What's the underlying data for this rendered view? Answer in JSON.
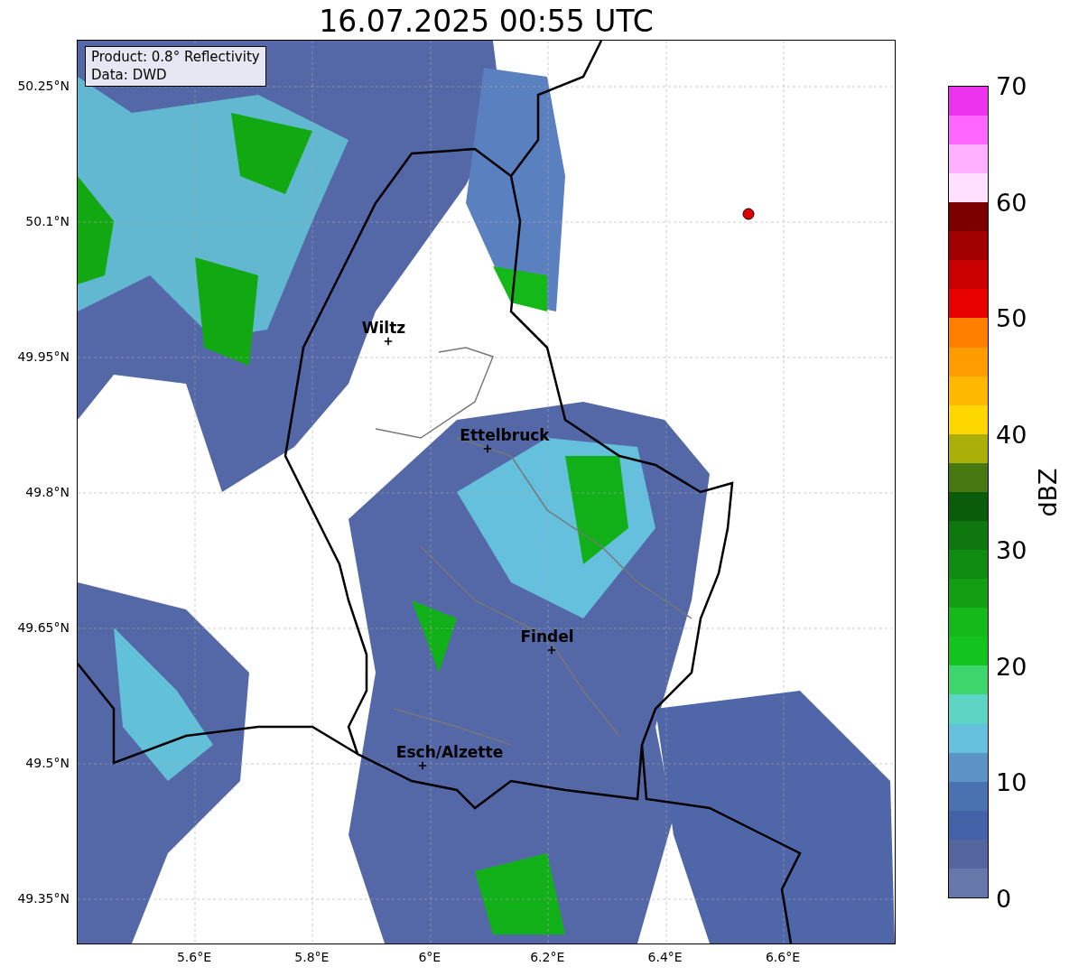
{
  "title": "16.07.2025 00:55 UTC",
  "info_box": [
    "Product: 0.8° Reflectivity",
    "Data: DWD"
  ],
  "lat_ticks": [
    "50.25°N",
    "50.1°N",
    "49.95°N",
    "49.8°N",
    "49.65°N",
    "49.5°N",
    "49.35°N"
  ],
  "lon_ticks": [
    "5.6°E",
    "5.8°E",
    "6°E",
    "6.2°E",
    "6.4°E",
    "6.6°E"
  ],
  "cities": [
    {
      "name": "Wiltz"
    },
    {
      "name": "Ettelbruck"
    },
    {
      "name": "Findel"
    },
    {
      "name": "Esch/Alzette"
    }
  ],
  "colorbar": {
    "label": "dBZ",
    "ticks": [
      "70",
      "60",
      "50",
      "40",
      "30",
      "20",
      "10",
      "0"
    ],
    "segments": [
      {
        "color": "#6677aa"
      },
      {
        "color": "#55669f"
      },
      {
        "color": "#4462a8"
      },
      {
        "color": "#4a72b0"
      },
      {
        "color": "#5a93c4"
      },
      {
        "color": "#64c0dc"
      },
      {
        "color": "#5ed4c4"
      },
      {
        "color": "#3cd66c"
      },
      {
        "color": "#14c41e"
      },
      {
        "color": "#14b818"
      },
      {
        "color": "#12a012"
      },
      {
        "color": "#108c10"
      },
      {
        "color": "#0e780e"
      },
      {
        "color": "#0a5c0a"
      },
      {
        "color": "#467a10"
      },
      {
        "color": "#aab008"
      },
      {
        "color": "#ffd700"
      },
      {
        "color": "#ffb800"
      },
      {
        "color": "#ff9c00"
      },
      {
        "color": "#ff7f00"
      },
      {
        "color": "#e60000"
      },
      {
        "color": "#c80000"
      },
      {
        "color": "#a00000"
      },
      {
        "color": "#7a0000"
      },
      {
        "color": "#ffe0ff"
      },
      {
        "color": "#ffb0ff"
      },
      {
        "color": "#ff66ff"
      },
      {
        "color": "#ee33ee"
      }
    ]
  }
}
